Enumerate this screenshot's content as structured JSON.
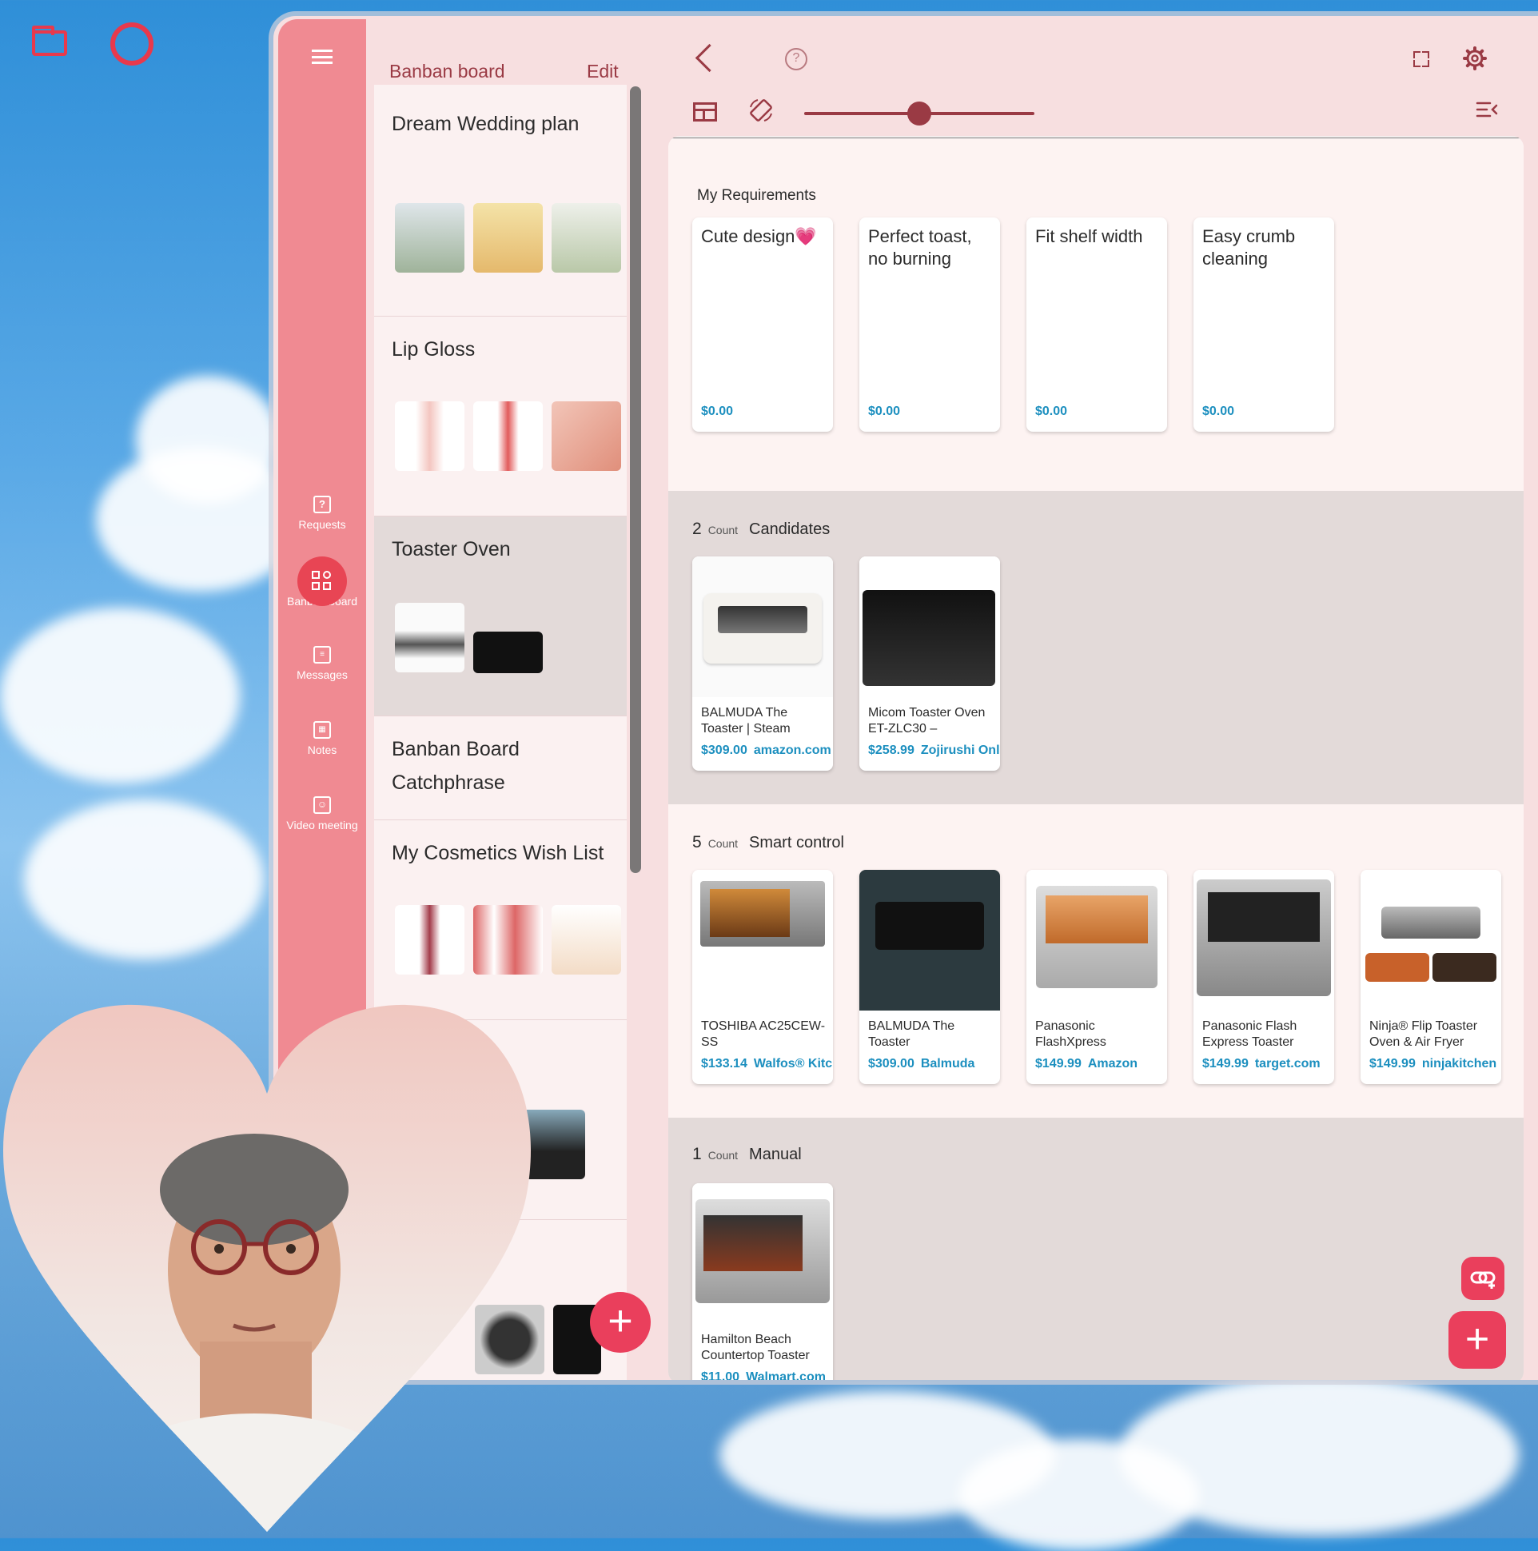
{
  "app": {
    "header_title": "Banban board",
    "edit_label": "Edit",
    "accent": "#ea3f5c",
    "rail_color": "#f08a92",
    "price_color": "#1c8fbf"
  },
  "rail": {
    "items": [
      {
        "label": "Requests",
        "icon": "question-box-icon"
      },
      {
        "label": "Banban board",
        "icon": "board-grid-icon",
        "active": true
      },
      {
        "label": "Messages",
        "icon": "message-icon"
      },
      {
        "label": "Notes",
        "icon": "calendar-notes-icon"
      },
      {
        "label": "Video meeting",
        "icon": "video-person-icon"
      }
    ]
  },
  "boards": [
    {
      "title": "Dream Wedding plan"
    },
    {
      "title": "Lip Gloss"
    },
    {
      "title": "Toaster Oven",
      "selected": true
    },
    {
      "title": "Banban Board Catchphrase"
    },
    {
      "title": "My Cosmetics Wish List"
    }
  ],
  "toolbar": {
    "zoom_level": 0.5
  },
  "requirements": {
    "title": "My Requirements",
    "cards": [
      {
        "text": "Cute design💗",
        "price": "$0.00"
      },
      {
        "text": "Perfect toast, no burning",
        "price": "$0.00"
      },
      {
        "text": "Fit shelf width",
        "price": "$0.00"
      },
      {
        "text": "Easy crumb cleaning",
        "price": "$0.00"
      }
    ]
  },
  "groups": [
    {
      "count": "2",
      "count_label": "Count",
      "title": "Candidates",
      "items": [
        {
          "name": "BALMUDA The Toaster | Steam",
          "price": "$309.00",
          "store": "amazon.com"
        },
        {
          "name": "Micom Toaster Oven ET-ZLC30 –",
          "price": "$258.99",
          "store": "Zojirushi Online"
        }
      ]
    },
    {
      "count": "5",
      "count_label": "Count",
      "title": "Smart control",
      "items": [
        {
          "name": "TOSHIBA AC25CEW-SS",
          "price": "$133.14",
          "store": "Walfos® Kitchen"
        },
        {
          "name": "BALMUDA The Toaster",
          "price": "$309.00",
          "store": "Balmuda"
        },
        {
          "name": "Panasonic FlashXpress",
          "price": "$149.99",
          "store": "Amazon"
        },
        {
          "name": "Panasonic Flash Express Toaster",
          "price": "$149.99",
          "store": "target.com"
        },
        {
          "name": "Ninja® Flip Toaster Oven & Air Fryer",
          "price": "$149.99",
          "store": "ninjakitchen"
        }
      ]
    },
    {
      "count": "1",
      "count_label": "Count",
      "title": "Manual",
      "items": [
        {
          "name": "Hamilton Beach Countertop Toaster",
          "price": "$11.00",
          "store": "Walmart.com"
        }
      ]
    }
  ]
}
